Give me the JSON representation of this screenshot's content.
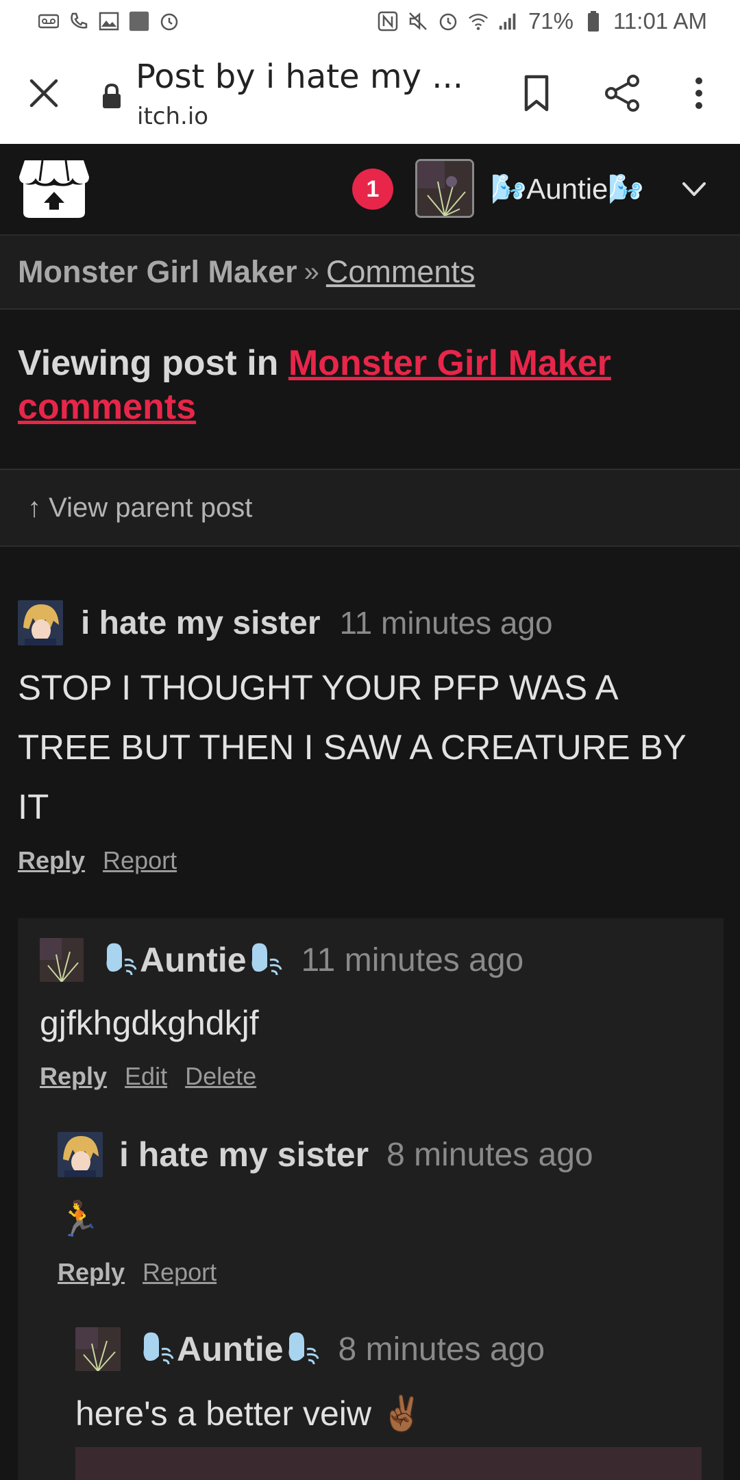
{
  "status_bar": {
    "battery_percent": "71%",
    "time": "11:01 AM",
    "left_icons": [
      "voicemail-icon",
      "missed-call-icon",
      "gallery-icon",
      "app-icon",
      "alarm-icon"
    ],
    "right_icons": [
      "nfc-icon",
      "mute-icon",
      "alarm-icon",
      "wifi-icon",
      "signal-icon",
      "battery-icon"
    ]
  },
  "browser": {
    "title": "Post by i hate my ...",
    "url": "itch.io"
  },
  "header": {
    "notification_count": "1",
    "username": "🌬️Auntie🌬️"
  },
  "breadcrumb": {
    "game": "Monster Girl Maker",
    "separator": "»",
    "link": "Comments"
  },
  "heading": {
    "prefix": "Viewing post in",
    "link": "Monster Girl Maker comments"
  },
  "parent_link": "↑ View parent post",
  "posts": [
    {
      "author": "i hate my sister",
      "time": "11 minutes ago",
      "body": "STOP I THOUGHT YOUR PFP WAS A TREE BUT THEN I SAW A CREATURE BY IT",
      "actions": [
        "Reply",
        "Report"
      ]
    },
    {
      "author": "Auntie",
      "time": "11 minutes ago",
      "body": "gjfkhgdkghdkjf",
      "actions": [
        "Reply",
        "Edit",
        "Delete"
      ]
    },
    {
      "author": "i hate my sister",
      "time": "8 minutes ago",
      "body": "🏃",
      "actions": [
        "Reply",
        "Report"
      ]
    },
    {
      "author": "Auntie",
      "time": "8 minutes ago",
      "body": "here's a better veiw ✌🏾"
    }
  ],
  "colors": {
    "accent": "#e8264a",
    "background": "#151515",
    "panel": "#1e1e1e",
    "nested_panel": "#1f1f1f"
  }
}
